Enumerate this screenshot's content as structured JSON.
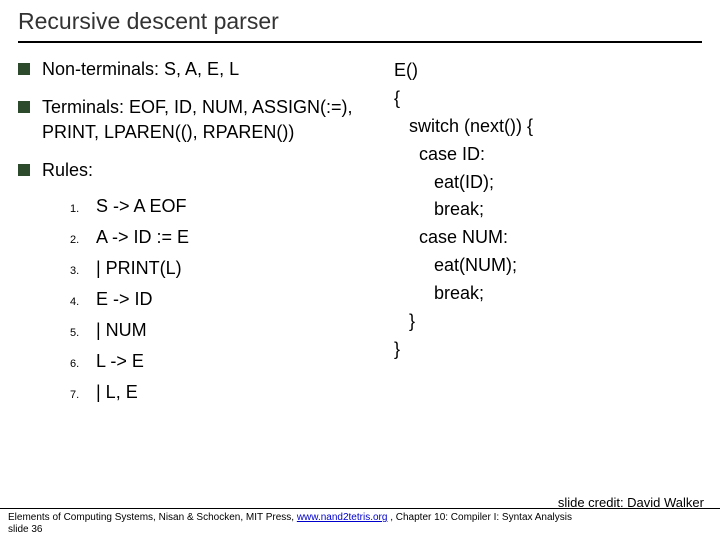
{
  "title": "Recursive descent parser",
  "bullets": {
    "nonterminals": "Non-terminals: S, A, E, L",
    "terminals": "Terminals: EOF, ID, NUM, ASSIGN(:=), PRINT, LPAREN((), RPAREN())",
    "rules_label": "Rules:"
  },
  "rules": [
    "S -> A EOF",
    "A -> ID := E",
    "   | PRINT(L)",
    "E -> ID",
    "   | NUM",
    "L -> E",
    "   | L, E"
  ],
  "code": "E()\n{\n   switch (next()) {\n     case ID:\n        eat(ID);\n        break;\n     case NUM:\n        eat(NUM);\n        break;\n   }\n}",
  "credit": "slide credit: David Walker",
  "footer": {
    "prefix": "Elements of Computing Systems, Nisan & Schocken, MIT Press, ",
    "link": "www.nand2tetris.org",
    "suffix": " , Chapter 10: Compiler I: Syntax Analysis",
    "slide": "slide 36"
  }
}
